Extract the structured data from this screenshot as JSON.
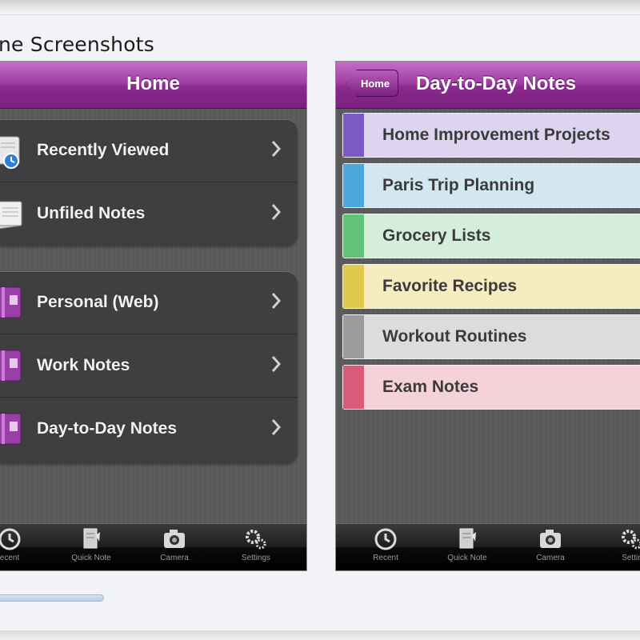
{
  "gallery": {
    "title": "ne Screenshots"
  },
  "home_screen": {
    "nav_title": "Home",
    "groups": [
      [
        {
          "label": "Recently Viewed",
          "icon": "clock-notes-icon"
        },
        {
          "label": "Unfiled Notes",
          "icon": "notes-stack-icon"
        }
      ],
      [
        {
          "label": "Personal (Web)",
          "icon": "notebook-icon"
        },
        {
          "label": "Work Notes",
          "icon": "notebook-icon"
        },
        {
          "label": "Day-to-Day Notes",
          "icon": "notebook-icon"
        }
      ]
    ],
    "tabs": [
      "ecent",
      "Quick Note",
      "Camera",
      "Settings"
    ]
  },
  "notebook_screen": {
    "back_label": "Home",
    "nav_title": "Day-to-Day Notes",
    "sections": [
      {
        "label": "Home Improvement Projects",
        "strip": "#7c5ac6",
        "bg": "#ddd5ef"
      },
      {
        "label": "Paris Trip Planning",
        "strip": "#4ba7dc",
        "bg": "#d3e7f3"
      },
      {
        "label": "Grocery Lists",
        "strip": "#63c27a",
        "bg": "#d4eedb"
      },
      {
        "label": "Favorite Recipes",
        "strip": "#e1c84f",
        "bg": "#f6ecc2"
      },
      {
        "label": "Workout Routines",
        "strip": "#9b9b9b",
        "bg": "#dcdcdc"
      },
      {
        "label": "Exam Notes",
        "strip": "#d95c7b",
        "bg": "#f5d2da"
      }
    ],
    "tabs": [
      "Recent",
      "Quick Note",
      "Camera",
      "Settin"
    ]
  },
  "colors": {
    "nav_purple": "#9b3aa0",
    "list_dark": "#3f3f42"
  }
}
